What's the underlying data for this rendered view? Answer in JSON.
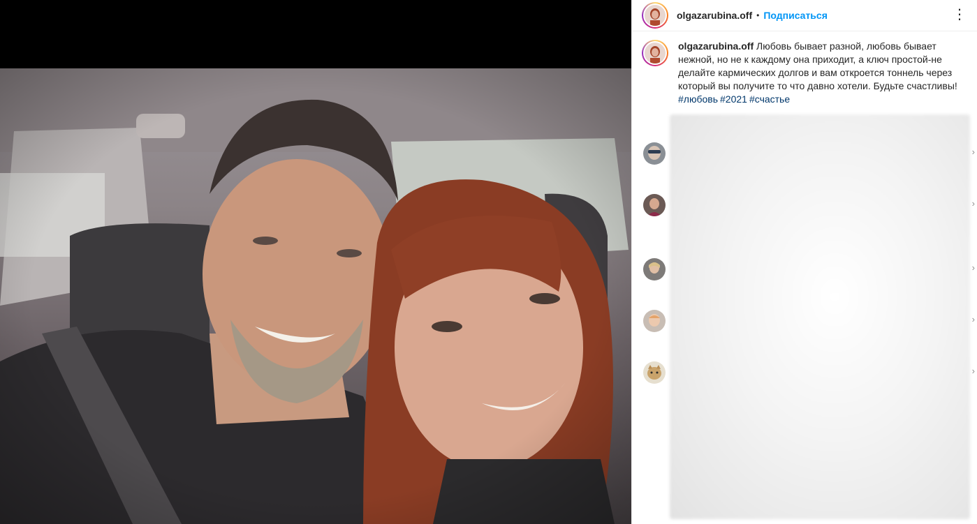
{
  "post": {
    "username": "olgazarubina.off",
    "separator": "•",
    "follow_label": "Подписаться",
    "more_label": "⋮",
    "caption_username": "olgazarubina.off",
    "caption_text": "Любовь бывает разной, любовь бывает нежной, но не к каждому она приходит, а ключ простой-не делайте кармических долгов и вам откроется тоннель через который вы получите то что давно хотели. Будьте счастливы!",
    "hashtags": [
      "#любовь",
      "#2021",
      "#счастье"
    ]
  },
  "comments": [
    {
      "avatar": "avatar-sunglasses",
      "chevron": "›"
    },
    {
      "avatar": "avatar-dark-hair",
      "chevron": "›"
    },
    {
      "avatar": "avatar-blonde",
      "chevron": "›"
    },
    {
      "avatar": "avatar-light",
      "chevron": "›"
    },
    {
      "avatar": "avatar-cat",
      "chevron": "›"
    }
  ],
  "colors": {
    "accent": "#0095f6",
    "hashtag": "#00376b",
    "border": "#efefef"
  }
}
